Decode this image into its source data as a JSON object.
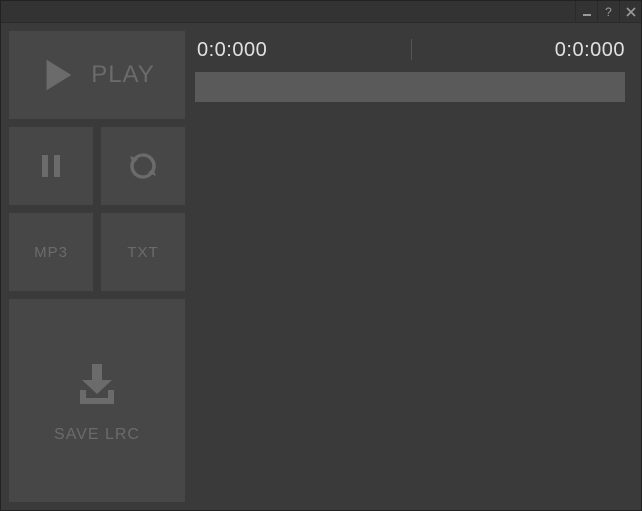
{
  "titlebar": {
    "minimize": "−",
    "help": "?",
    "close": "×"
  },
  "sidebar": {
    "play_label": "PLAY",
    "mp3_label": "MP3",
    "txt_label": "TXT",
    "save_label": "SAVE LRC"
  },
  "player": {
    "time_elapsed": "0:0:000",
    "time_total": "0:0:000"
  }
}
